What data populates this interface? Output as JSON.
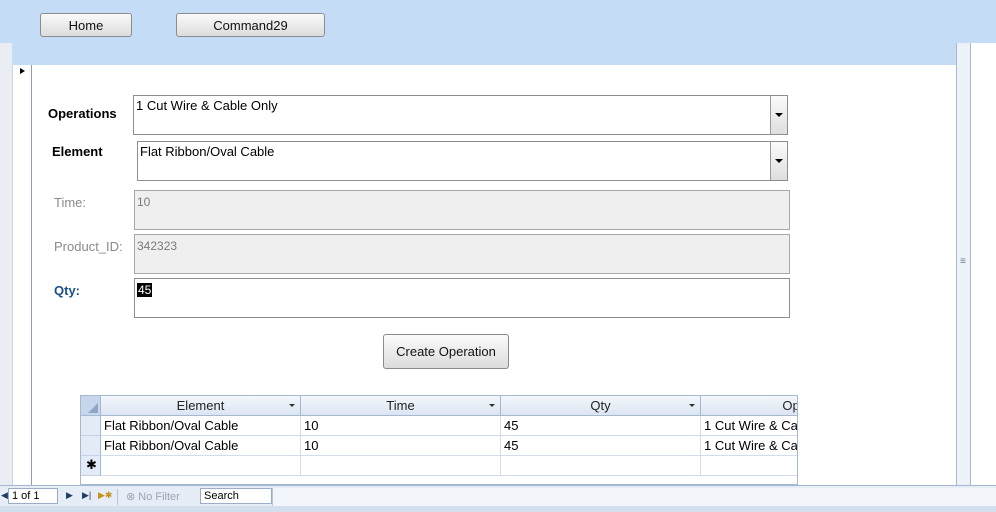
{
  "toolbar": {
    "home_label": "Home",
    "command_label": "Command29"
  },
  "form": {
    "operations_label": "Operations",
    "operations_value": "1 Cut Wire & Cable Only",
    "element_label": "Element",
    "element_value": "Flat Ribbon/Oval Cable",
    "time_label": "Time:",
    "time_value": "10",
    "product_label": "Product_ID:",
    "product_value": "342323",
    "qty_label": "Qty:",
    "qty_value": "45",
    "create_label": "Create Operation"
  },
  "grid": {
    "columns": [
      "Element",
      "Time",
      "Qty",
      "Opera"
    ],
    "rows": [
      [
        "Flat Ribbon/Oval Cable",
        "10",
        "45",
        "1 Cut Wire & Ca"
      ],
      [
        "Flat Ribbon/Oval Cable",
        "10",
        "45",
        "1 Cut Wire & Ca"
      ]
    ],
    "new_row_marker": "✱"
  },
  "nav": {
    "record": "1 of 1",
    "filter": "No Filter",
    "search": "Search"
  },
  "icons": {
    "first": "first-record-icon",
    "prev": "previous-record-icon",
    "next": "next-record-icon",
    "last": "last-record-icon",
    "new": "new-record-icon",
    "filter": "filter-icon"
  },
  "colors": {
    "header_band": "#c5dcf7",
    "qty_label": "#1b4f8a"
  }
}
